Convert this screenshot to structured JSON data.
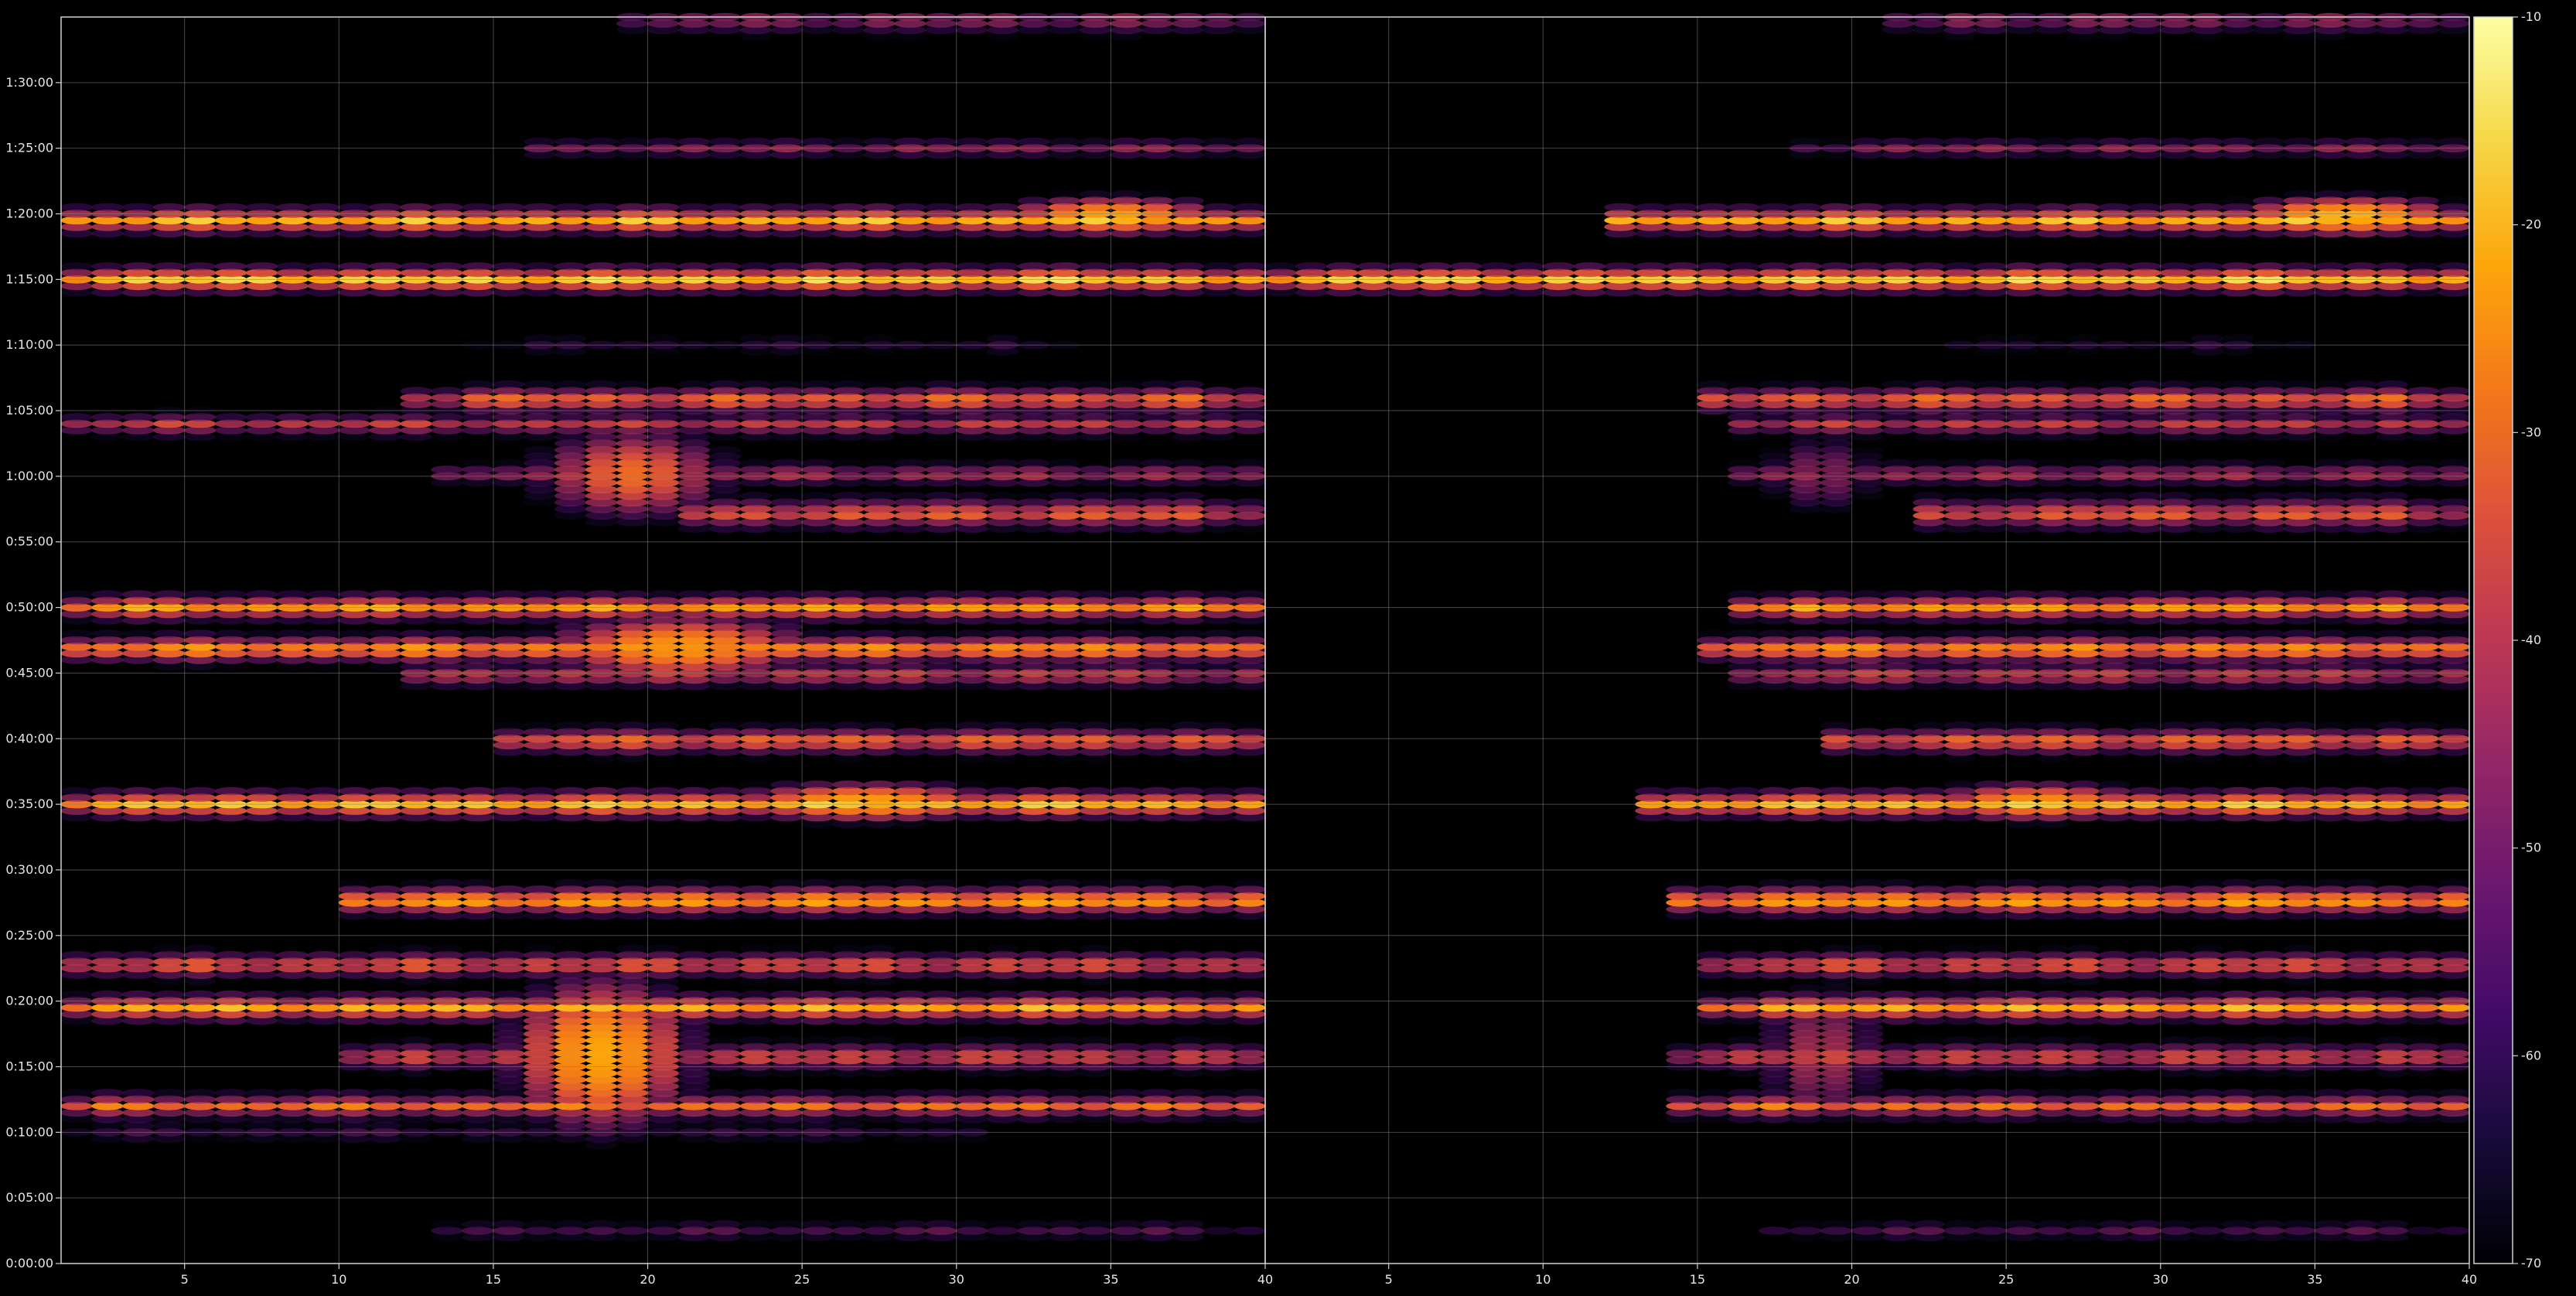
{
  "chart_data": {
    "type": "heatmap",
    "title": "",
    "xlabel": "",
    "ylabel": "",
    "colormap": "inferno",
    "grid": true,
    "background": "#000000",
    "grid_color": "#808080",
    "panels": [
      {
        "name": "",
        "xlim": [
          1,
          40
        ],
        "xticks": [
          5,
          10,
          15,
          20,
          25,
          30,
          35,
          40
        ]
      },
      {
        "name": "",
        "xlim": [
          1,
          40
        ],
        "xticks": [
          5,
          10,
          15,
          20,
          25,
          30,
          35,
          40
        ]
      }
    ],
    "y_axis": {
      "ylim_seconds": [
        0,
        5700
      ],
      "ticks": [
        {
          "label": "0:00:00",
          "seconds": 0
        },
        {
          "label": "0:05:00",
          "seconds": 300
        },
        {
          "label": "0:10:00",
          "seconds": 600
        },
        {
          "label": "0:15:00",
          "seconds": 900
        },
        {
          "label": "0:20:00",
          "seconds": 1200
        },
        {
          "label": "0:25:00",
          "seconds": 1500
        },
        {
          "label": "0:30:00",
          "seconds": 1800
        },
        {
          "label": "0:35:00",
          "seconds": 2100
        },
        {
          "label": "0:40:00",
          "seconds": 2400
        },
        {
          "label": "0:45:00",
          "seconds": 2700
        },
        {
          "label": "0:50:00",
          "seconds": 3000
        },
        {
          "label": "0:55:00",
          "seconds": 3300
        },
        {
          "label": "1:00:00",
          "seconds": 3600
        },
        {
          "label": "1:05:00",
          "seconds": 3900
        },
        {
          "label": "1:10:00",
          "seconds": 4200
        },
        {
          "label": "1:15:00",
          "seconds": 4500
        },
        {
          "label": "1:20:00",
          "seconds": 4800
        },
        {
          "label": "1:25:00",
          "seconds": 5100
        },
        {
          "label": "1:30:00",
          "seconds": 5400
        }
      ]
    },
    "colorbar": {
      "range": [
        -70,
        -10
      ],
      "ticks": [
        "-10",
        "-20",
        "-30",
        "-40",
        "-50",
        "-60",
        "-70"
      ]
    },
    "bands": [
      {
        "t": 5685,
        "vmax": -42,
        "p1": [
          20,
          39
        ],
        "p2": [
          22,
          39
        ],
        "decay": 0.35
      },
      {
        "t": 5100,
        "vmax": -45,
        "p1": [
          17,
          39
        ],
        "p2": [
          19,
          39
        ],
        "decay": 0.45
      },
      {
        "t": 4770,
        "vmax": -21,
        "p1": [
          1,
          39
        ],
        "p2": [
          13,
          39
        ],
        "decay": 0.55
      },
      {
        "t": 4500,
        "vmax": -18,
        "p1": [
          1,
          39
        ],
        "p2": [
          1,
          39
        ],
        "decay": 0.6
      },
      {
        "t": 4500,
        "vmax": -20,
        "p1": [
          0,
          0
        ],
        "p2": [
          17,
          39
        ],
        "decay": 0.6
      },
      {
        "t": 4200,
        "vmax": -58,
        "p1": [
          15,
          33
        ],
        "p2": [
          24,
          34
        ],
        "decay": 0.3
      },
      {
        "t": 3950,
        "vmax": -28,
        "p1": [
          13,
          39
        ],
        "p2": [
          16,
          39
        ],
        "decay": 0.5
      },
      {
        "t": 3835,
        "vmax": -36,
        "p1": [
          1,
          39
        ],
        "p2": [
          17,
          39
        ],
        "decay": 0.5
      },
      {
        "t": 3610,
        "vmax": -38,
        "p1": [
          14,
          39
        ],
        "p2": [
          17,
          39
        ],
        "decay": 0.5
      },
      {
        "t": 3430,
        "vmax": -30,
        "p1": [
          22,
          39
        ],
        "p2": [
          23,
          39
        ],
        "decay": 0.4
      },
      {
        "t": 3000,
        "vmax": -24,
        "p1": [
          1,
          39
        ],
        "p2": [
          17,
          39
        ],
        "decay": 0.55
      },
      {
        "t": 2810,
        "vmax": -22,
        "p1": [
          1,
          39
        ],
        "p2": [
          16,
          39
        ],
        "decay": 0.55
      },
      {
        "t": 2690,
        "vmax": -34,
        "p1": [
          13,
          39
        ],
        "p2": [
          17,
          39
        ],
        "decay": 0.5
      },
      {
        "t": 2390,
        "vmax": -28,
        "p1": [
          16,
          39
        ],
        "p2": [
          20,
          39
        ],
        "decay": 0.5
      },
      {
        "t": 2100,
        "vmax": -20,
        "p1": [
          1,
          39
        ],
        "p2": [
          14,
          39
        ],
        "decay": 0.55
      },
      {
        "t": 1660,
        "vmax": -20,
        "p1": [
          11,
          39
        ],
        "p2": [
          15,
          39
        ],
        "decay": 0.55
      },
      {
        "t": 1365,
        "vmax": -30,
        "p1": [
          1,
          39
        ],
        "p2": [
          16,
          39
        ],
        "decay": 0.5
      },
      {
        "t": 1170,
        "vmax": -22,
        "p1": [
          1,
          39
        ],
        "p2": [
          16,
          39
        ],
        "decay": 0.55
      },
      {
        "t": 945,
        "vmax": -32,
        "p1": [
          11,
          39
        ],
        "p2": [
          15,
          39
        ],
        "decay": 0.45
      },
      {
        "t": 720,
        "vmax": -30,
        "p1": [
          1,
          39
        ],
        "p2": [
          15,
          39
        ],
        "decay": 0.5
      },
      {
        "t": 600,
        "vmax": -55,
        "p1": [
          1,
          30
        ],
        "p2": [
          0,
          0
        ],
        "decay": 0.3
      },
      {
        "t": 150,
        "vmax": -52,
        "p1": [
          14,
          39
        ],
        "p2": [
          18,
          39
        ],
        "decay": 0.35
      }
    ],
    "blobs": [
      {
        "x": 19.5,
        "t": 3610,
        "panel": 1,
        "v": -30,
        "sx": 2.2,
        "st": 150
      },
      {
        "x": 18.5,
        "t": 960,
        "panel": 1,
        "v": -22,
        "sx": 2.0,
        "st": 240
      },
      {
        "x": 21.0,
        "t": 2820,
        "panel": 1,
        "v": -24,
        "sx": 3.0,
        "st": 100
      },
      {
        "x": 27.0,
        "t": 2110,
        "panel": 1,
        "v": -22,
        "sx": 3.0,
        "st": 60
      },
      {
        "x": 35.0,
        "t": 4790,
        "panel": 1,
        "v": -22,
        "sx": 2.5,
        "st": 60
      },
      {
        "x": 26.0,
        "t": 2110,
        "panel": 2,
        "v": -24,
        "sx": 2.5,
        "st": 60
      },
      {
        "x": 36.0,
        "t": 4790,
        "panel": 2,
        "v": -20,
        "sx": 2.5,
        "st": 60
      },
      {
        "x": 19.0,
        "t": 3610,
        "panel": 2,
        "v": -44,
        "sx": 1.5,
        "st": 140
      },
      {
        "x": 19.0,
        "t": 960,
        "panel": 2,
        "v": -40,
        "sx": 1.5,
        "st": 240
      }
    ]
  }
}
